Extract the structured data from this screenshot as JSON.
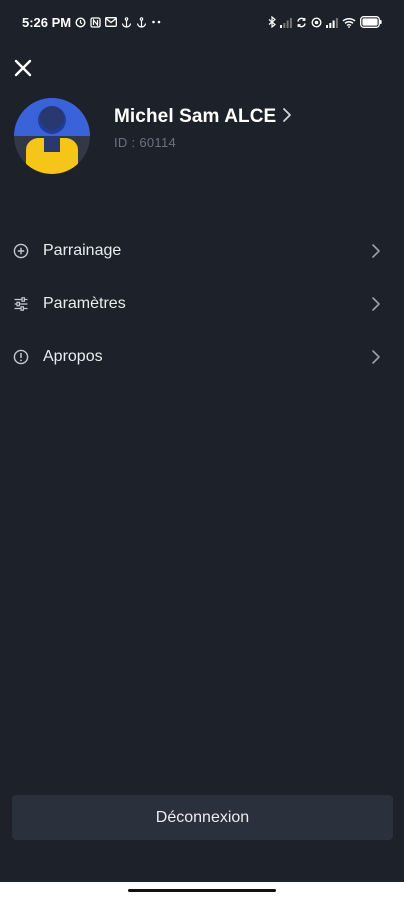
{
  "status_bar": {
    "time": "5:26 PM",
    "left_icons": [
      "alarm-icon",
      "nfc-icon",
      "gmail-icon",
      "anchor-icon",
      "anchor-icon",
      "more-dots-icon"
    ],
    "right_icons": [
      "bluetooth-icon",
      "signal-weak-icon",
      "sync-icon",
      "location-icon",
      "signal-icon",
      "wifi-icon",
      "battery-icon"
    ],
    "battery": "88"
  },
  "profile": {
    "name": "Michel Sam ALCE",
    "id": "ID : 60114"
  },
  "menu": {
    "items": [
      {
        "label": "Parrainage",
        "icon": "plus-circle-icon"
      },
      {
        "label": "Paramètres",
        "icon": "sliders-icon"
      },
      {
        "label": "Apropos",
        "icon": "info-circle-icon"
      }
    ]
  },
  "logout": {
    "label": "Déconnexion"
  },
  "colors": {
    "background": "#1c212a",
    "button_bg": "#2b313c",
    "text": "#eaecef",
    "muted": "#6b7280",
    "avatar_blue": "#3b63d9",
    "avatar_yellow": "#f5c518"
  }
}
